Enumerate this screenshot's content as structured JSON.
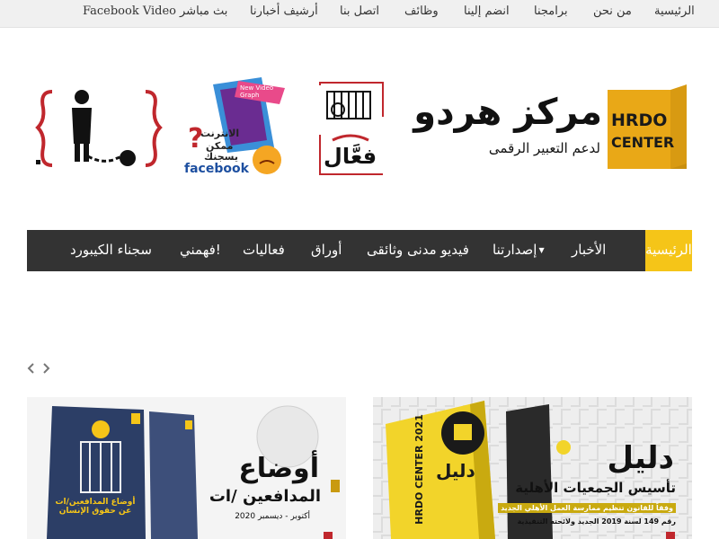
{
  "topbar": {
    "links": [
      "الرئيسية",
      "من نحن",
      "برامجنا",
      "انضم إلينا",
      "وظائف",
      "اتصل بنا",
      "أرشيف أخبارنا",
      "بث مباشر",
      "Facebook Video"
    ]
  },
  "header": {
    "logo_latin": "HRDO CENTER",
    "logo_title": "مركز هردو",
    "logo_subtitle": "لدعم التعبير الرقمى",
    "banner2_word": "فعَّال",
    "banner3_badge": "New Video Graph",
    "banner3_line1": "الانترنت",
    "banner3_line2": "ممكن",
    "banner3_line3": "يسجنك",
    "banner3_brand": "facebook"
  },
  "nav": {
    "items": [
      "الرئيسية",
      "الأخبار",
      "إصدارتنا",
      "فيديو مدنى وثائقى",
      "أوراق",
      "فعاليات",
      "فهمني!",
      "سجناء الكيبورد"
    ]
  },
  "slider": {
    "prev_icon": "chevron-left-icon",
    "next_icon": "chevron-right-icon"
  },
  "cards": [
    {
      "title": "دليل",
      "subtitle": "تأسيس الجمعيات الأهلية",
      "desc1": "وفقاً للقانون تنظيم ممارسة العمل الأهلي الجديد",
      "desc2": "رقم 149 لسنة 2019 الجديد ولائحته التنفيذية",
      "book_text": "HRDO CENTER 2021",
      "book_title": "دليل"
    },
    {
      "title": "أوضاع",
      "subtitle": "المدافعين /ات",
      "date": "أكتوبر - ديسمبر 2020",
      "book_text": "أوضاع المدافعين/ات عن حقوق الإنسان"
    }
  ],
  "colors": {
    "accent": "#f5c518",
    "nav_bg": "#333333",
    "topbar_bg": "#f0f0f0"
  }
}
